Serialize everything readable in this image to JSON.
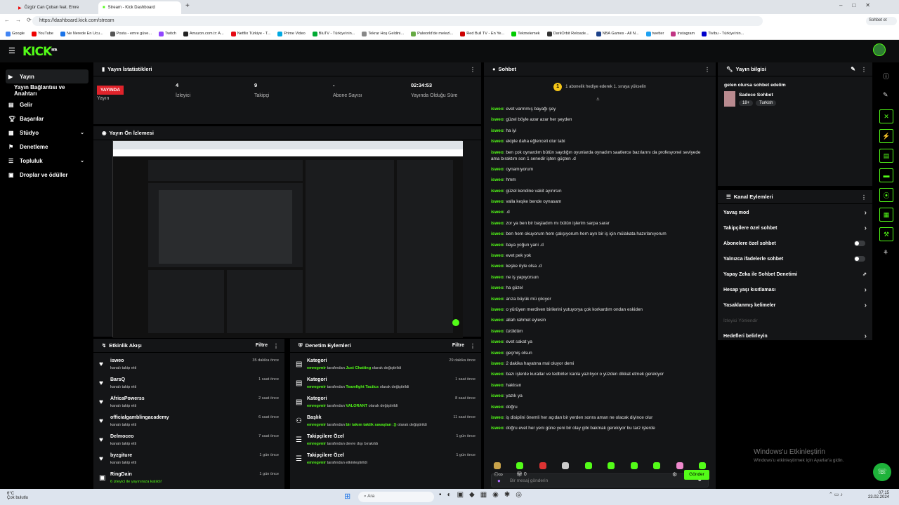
{
  "browser": {
    "tabs": [
      "Özgür Can Çoban feat. Emre",
      "Stream - Kick Dashboard"
    ],
    "url": "https://dashboard.kick.com/stream",
    "chat_btn": "Sohbet et",
    "bookmarks": [
      "Google",
      "YouTube",
      "Ne Nerede En Ucu...",
      "Posta - emre güve...",
      "Twitch",
      "Amazon.com.tr: A...",
      "Netflix Türkiye - T...",
      "Prime Video",
      "BluTV - Türkiye'nin...",
      "Tekrar Hoş Geldini...",
      "Palworld'de melezl...",
      "Red Bull TV - En Ye...",
      "Tekmelemek",
      "DarkOrbit Reloade...",
      "NBA Games - All N...",
      "twetter",
      "Instagram",
      "Tivibu - Türkiye'nin..."
    ]
  },
  "logo": "KICK",
  "logo_sup": "BETA",
  "sidebar": [
    {
      "label": "Yayın"
    },
    {
      "label": "Yayın Bağlantısı ve Anahtarı"
    },
    {
      "label": "Gelir"
    },
    {
      "label": "Başarılar"
    },
    {
      "label": "Stüdyo"
    },
    {
      "label": "Denetleme"
    },
    {
      "label": "Topluluk"
    },
    {
      "label": "Droplar ve ödüller"
    }
  ],
  "stats": {
    "title": "Yayın İstatistikleri",
    "live": "YAYINDA",
    "live_label": "Yayın",
    "viewers": "4",
    "viewers_label": "İzleyici",
    "followers": "9",
    "followers_label": "Takipçi",
    "subs": "-",
    "subs_label": "Abone Sayısı",
    "uptime": "02:34:53",
    "uptime_label": "Yayında Olduğu Süre"
  },
  "preview": {
    "title": "Yayın Ön İzlemesi"
  },
  "activity": {
    "title": "Etkinlik Akışı",
    "filter": "Filtre",
    "items": [
      {
        "name": "isweo",
        "sub": "kanalı takip etti",
        "time": "35 dakika önce"
      },
      {
        "name": "BarsQ",
        "sub": "kanalı takip etti",
        "time": "1 saat önce"
      },
      {
        "name": "AfricaPowerss",
        "sub": "kanalı takip etti",
        "time": "2 saat önce"
      },
      {
        "name": "officialgamblingacademy",
        "sub": "kanalı takip etti",
        "time": "6 saat önce"
      },
      {
        "name": "Delmoceo",
        "sub": "kanalı takip etti",
        "time": "7 saat önce"
      },
      {
        "name": "byzgiture",
        "sub": "kanalı takip etti",
        "time": "1 gün önce"
      },
      {
        "name": "RingDain",
        "sub": "6 izleyici ile yayınınıza katıldı!",
        "time": "1 gün önce"
      }
    ]
  },
  "moderation": {
    "title": "Denetim Eylemleri",
    "filter": "Filtre",
    "items": [
      {
        "title": "Kategori",
        "user": "emregvnir",
        "mid": "tarafından",
        "hl": "Just Chatting",
        "end": "olarak değiştirildi",
        "time": "29 dakika önce"
      },
      {
        "title": "Kategori",
        "user": "emregvnir",
        "mid": "tarafından",
        "hl": "Teamfight Tactics",
        "end": "olarak değiştirildi",
        "time": "1 saat önce"
      },
      {
        "title": "Kategori",
        "user": "emregvnir",
        "mid": "tarafından",
        "hl": "VALORANT",
        "end": "olarak değiştirildi",
        "time": "8 saat önce"
      },
      {
        "title": "Başlık",
        "user": "emregvnir",
        "mid": "tarafından",
        "hl": "bir takım taktik savaşları :))",
        "end": "olarak değiştirildi",
        "time": "11 saat önce"
      },
      {
        "title": "Takipçilere Özel",
        "user": "emregvnir",
        "mid": "tarafından devre dışı bırakıldı",
        "hl": "",
        "end": "",
        "time": "1 gün önce"
      },
      {
        "title": "Takipçilere Özel",
        "user": "emregvnir",
        "mid": "tarafından etkinleştirildi",
        "hl": "",
        "end": "",
        "time": "1 gün önce"
      }
    ]
  },
  "chat": {
    "title": "Sohbet",
    "pinned": "1 abonelik hediye ederek 1. sıraya yükselin",
    "placeholder": "Bir mesaj gönderin",
    "send": "Gönder",
    "count": "0",
    "messages": [
      {
        "u": "isweo",
        "m": "evet varmmış bayağı şey"
      },
      {
        "u": "isweo",
        "m": "güzel böyle azar azar her şeyden"
      },
      {
        "u": "isweo",
        "m": "ha iyi"
      },
      {
        "u": "isweo",
        "m": "ekiple daha eğlenceli olur tabi"
      },
      {
        "u": "isweo",
        "m": "ben çok oynardım bütün saydığın oyunlarda oynadım saatlerce bazılarını da profesyonel seviyede ama bıraktım son 1 senedir işten güçten .d"
      },
      {
        "u": "isweo",
        "m": "oynamıyorum"
      },
      {
        "u": "isweo",
        "m": "hmm"
      },
      {
        "u": "isweo",
        "m": "güzel kendine vakit ayırırsın"
      },
      {
        "u": "isweo",
        "m": "valla keşke bende oynasam"
      },
      {
        "u": "isweo",
        "m": ".d"
      },
      {
        "u": "isweo",
        "m": "zor ya ben bir başladım mı bütün işlerim sarpa sarar"
      },
      {
        "u": "isweo",
        "m": "ben hem okuyorum hem çalışıyorum hem ayrı bir iş için mülakata hazırlanıyorum"
      },
      {
        "u": "isweo",
        "m": "baya yoğun yani .d"
      },
      {
        "u": "isweo",
        "m": "evet pek yok"
      },
      {
        "u": "isweo",
        "m": "keşke öyle olsa .d"
      },
      {
        "u": "isweo",
        "m": "ne iş yapıyorsun"
      },
      {
        "u": "isweo",
        "m": "ha güzel"
      },
      {
        "u": "isweo",
        "m": "arıza büyük mü çıkıyor"
      },
      {
        "u": "isweo",
        "m": "o yürüyen merdiven birilerini yutuyorya çok korkardım ondan eskiden"
      },
      {
        "u": "isweo",
        "m": "allah rahmet eylesin"
      },
      {
        "u": "isweo",
        "m": "üzüldüm"
      },
      {
        "u": "isweo",
        "m": "evet sakat ya"
      },
      {
        "u": "isweo",
        "m": "geçmiş olsun"
      },
      {
        "u": "isweo",
        "m": "2 dakika hayatına mal oluyor demi"
      },
      {
        "u": "isweo",
        "m": "bazı işlerde kurallar ve tedbirler kanla yazılıyor o yüzden dikkat etmek gerekiyor"
      },
      {
        "u": "isweo",
        "m": "haklısın"
      },
      {
        "u": "isweo",
        "m": "yazık ya"
      },
      {
        "u": "isweo",
        "m": "doğru"
      },
      {
        "u": "isweo",
        "m": "iş disiplini önemli her açıdan bir yerden sonra aman ne olacak diyince olur"
      },
      {
        "u": "isweo",
        "m": "doğru evet her yeni güne yeni bir olay gibi bakmak gerekiyor bu tarz işlerde"
      }
    ]
  },
  "info": {
    "title": "Yayın bilgisi",
    "stream_title": "gelen olursa sohbet edelim",
    "category": "Sadece Sohbet",
    "tag1": "18+",
    "tag2": "Turkish"
  },
  "channel": {
    "title": "Kanal Eylemleri",
    "items": [
      {
        "label": "Yavaş mod",
        "kind": "arrow"
      },
      {
        "label": "Takipçilere özel sohbet",
        "kind": "arrow"
      },
      {
        "label": "Abonelere özel sohbet",
        "kind": "toggle"
      },
      {
        "label": "Yalnızca ifadelerle sohbet",
        "kind": "toggle"
      },
      {
        "label": "Yapay Zeka ile Sohbet Denetimi",
        "kind": "link"
      },
      {
        "label": "Hesap yaşı kısıtlaması",
        "kind": "arrow"
      },
      {
        "label": "Yasaklanmış kelimeler",
        "kind": "arrow"
      },
      {
        "label": "İzleyici Yönlendir",
        "kind": "none"
      },
      {
        "label": "Hedefleri belirleyin",
        "kind": "arrow"
      }
    ]
  },
  "watermark": {
    "line1": "Windows'u Etkinleştirin",
    "line2": "Windows'u etkinleştirmek için Ayarlar'a gidin."
  },
  "taskbar": {
    "weather_temp": "6°C",
    "weather_desc": "Çok bulutlu",
    "search": "Ara",
    "time": "07:15",
    "date": "23.02.2024"
  },
  "colors": {
    "accent": "#53fc18",
    "live": "#e0232b",
    "panel": "#141517"
  }
}
